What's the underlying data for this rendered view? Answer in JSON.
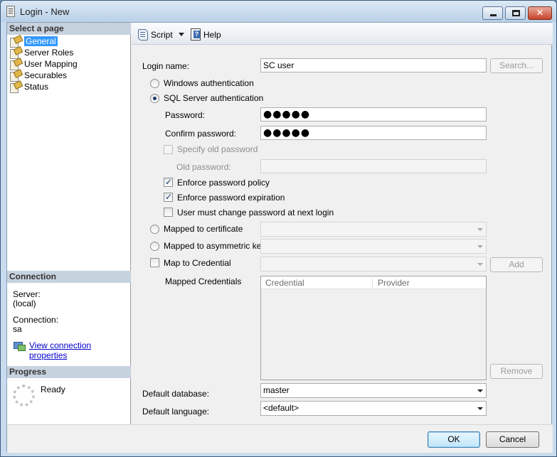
{
  "window": {
    "title": "Login - New"
  },
  "left": {
    "select_header": "Select a page",
    "pages": [
      "General",
      "Server Roles",
      "User Mapping",
      "Securables",
      "Status"
    ],
    "connection_header": "Connection",
    "server_label": "Server:",
    "server_value": "(local)",
    "connection_label": "Connection:",
    "connection_value": "sa",
    "view_link": "View connection properties",
    "progress_header": "Progress",
    "progress_status": "Ready"
  },
  "toolbar": {
    "script_label": "Script",
    "help_label": "Help"
  },
  "form": {
    "login_name_label": "Login name:",
    "login_name_value": "SC user",
    "search_button": "Search...",
    "windows_auth": "Windows authentication",
    "sql_auth": "SQL Server authentication",
    "password_label": "Password:",
    "password_value": "●●●●●",
    "confirm_label": "Confirm password:",
    "confirm_value": "●●●●●",
    "specify_old": "Specify old password",
    "old_password_label": "Old password:",
    "enforce_policy": "Enforce password policy",
    "enforce_expiration": "Enforce password expiration",
    "must_change": "User must change password at next login",
    "mapped_cert": "Mapped to certificate",
    "mapped_asym": "Mapped to asymmetric key",
    "map_credential": "Map to Credential",
    "add_button": "Add",
    "mapped_credentials_label": "Mapped Credentials",
    "grid_columns": [
      "Credential",
      "Provider"
    ],
    "remove_button": "Remove",
    "default_db_label": "Default database:",
    "default_db_value": "master",
    "default_lang_label": "Default language:",
    "default_lang_value": "<default>"
  },
  "buttons": {
    "ok": "OK",
    "cancel": "Cancel"
  },
  "state": {
    "auth_mode": "sql",
    "enforce_policy_checked": true,
    "enforce_expiration_checked": true,
    "must_change_checked": false,
    "specify_old_checked": false,
    "map_credential_checked": false,
    "selected_page": "General"
  }
}
